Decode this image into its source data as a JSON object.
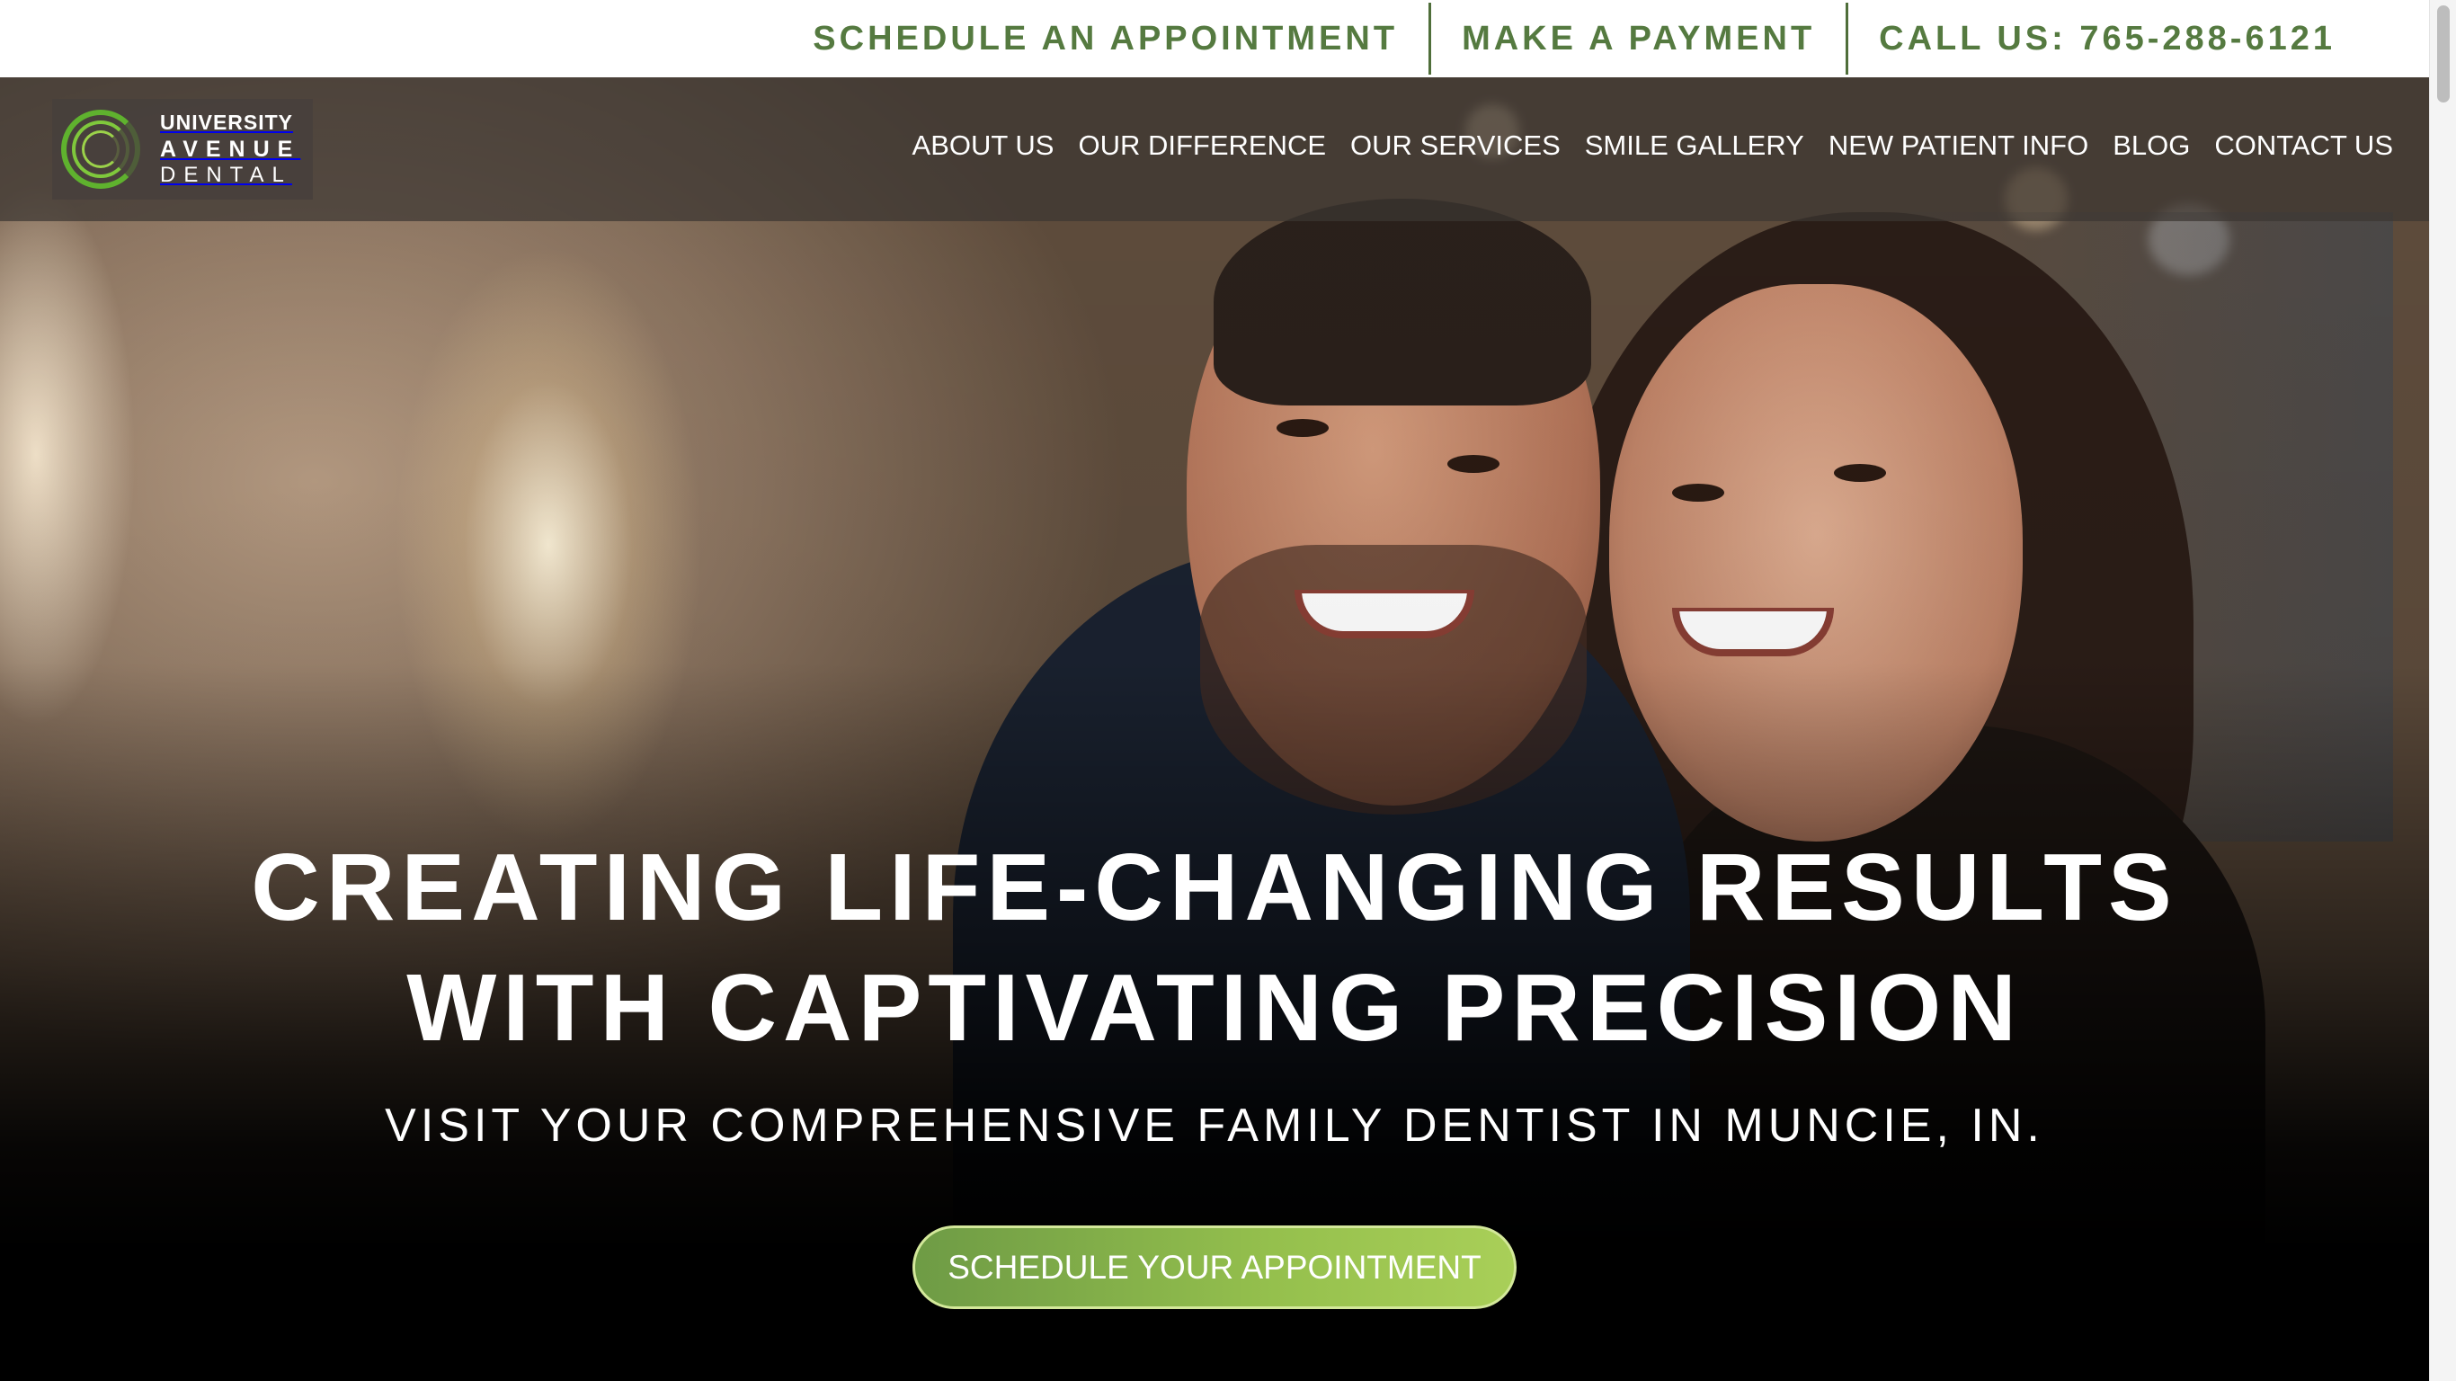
{
  "topbar": {
    "schedule": "SCHEDULE AN APPOINTMENT",
    "payment": "MAKE A PAYMENT",
    "call": "CALL US: 765-288-6121"
  },
  "logo": {
    "line1": "UNIVERSITY",
    "line2": "AVENUE",
    "line3": "DENTAL"
  },
  "nav": {
    "items": [
      {
        "label": "ABOUT US"
      },
      {
        "label": "OUR DIFFERENCE"
      },
      {
        "label": "OUR SERVICES"
      },
      {
        "label": "SMILE GALLERY"
      },
      {
        "label": "NEW PATIENT INFO"
      },
      {
        "label": "BLOG"
      },
      {
        "label": "CONTACT US"
      }
    ]
  },
  "hero": {
    "headline_line1": "CREATING LIFE-CHANGING RESULTS",
    "headline_line2": "WITH CAPTIVATING PRECISION",
    "subheadline": "VISIT YOUR COMPREHENSIVE FAMILY DENTIST IN MUNCIE, IN.",
    "cta_label": "SCHEDULE YOUR APPOINTMENT"
  },
  "colors": {
    "brand_green": "#557a40",
    "cta_green": "#8ab54a",
    "nav_overlay": "#3c3632"
  }
}
